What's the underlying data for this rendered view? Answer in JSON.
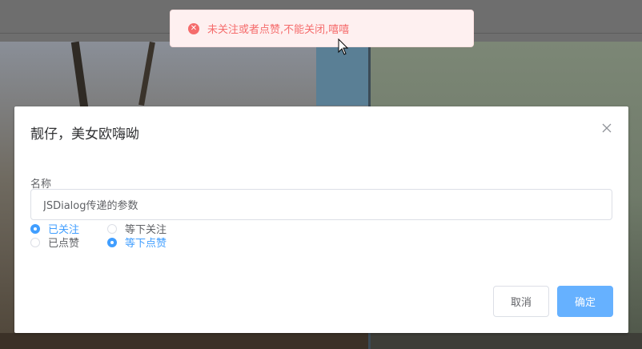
{
  "toast": {
    "message": "未关注或者点赞,不能关闭,嘻嘻",
    "icon": "error-circle-icon",
    "color": "#f56c6c"
  },
  "dialog": {
    "title": "靓仔，美女欧嗨呦",
    "field_label": "名称",
    "name_value": "JSDialog传递的参数",
    "radios": [
      {
        "label": "已关注",
        "checked": true
      },
      {
        "label": "等下关注",
        "checked": false
      },
      {
        "label": "已点赞",
        "checked": false
      },
      {
        "label": "等下点赞",
        "checked": true
      }
    ],
    "cancel_label": "取消",
    "ok_label": "确定"
  },
  "colors": {
    "primary": "#409eff",
    "primary_light": "#66b1ff",
    "error": "#f56c6c"
  }
}
